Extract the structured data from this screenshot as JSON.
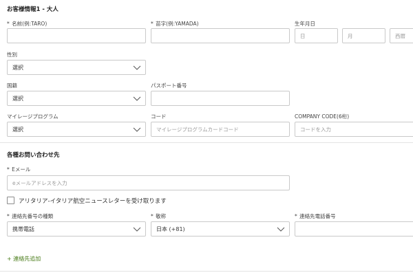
{
  "passenger": {
    "heading": "お客様情報1 - 大人",
    "first_name": {
      "label": "名前(例:TARO)",
      "required_mark": "*",
      "value": ""
    },
    "last_name": {
      "label": "苗字(例:YAMADA)",
      "required_mark": "*",
      "value": ""
    },
    "birth_date": {
      "label": "生年月日",
      "day_placeholder": "日",
      "month_placeholder": "月",
      "year_placeholder": "西暦"
    },
    "gender": {
      "label": "性別",
      "selected": "選択"
    },
    "nationality": {
      "label": "国籍",
      "selected": "選択"
    },
    "passport": {
      "label": "パスポート番号",
      "value": ""
    },
    "mileage_program": {
      "label": "マイレージプログラム",
      "selected": "選択"
    },
    "code": {
      "label": "コード",
      "placeholder": "マイレージプログラムカードコード"
    },
    "company_code": {
      "label": "COMPANY CODE(6桁)",
      "placeholder": "コードを入力"
    }
  },
  "contact": {
    "heading": "各種お問い合わせ先",
    "email": {
      "label": "Eメール",
      "required_mark": "*",
      "placeholder": "eメールアドレスを入力"
    },
    "newsletter_label": "アリタリア-イタリア航空ニュースレターを受け取ります",
    "newsletter_checked": false,
    "phone_type": {
      "label": "連絡先番号の種類",
      "required_mark": "*",
      "selected": "携帯電話"
    },
    "country_code": {
      "label": "敬称",
      "required_mark": "*",
      "selected": "日本 (+81)"
    },
    "phone_number": {
      "label": "連絡先電話番号",
      "required_mark": "*",
      "value": ""
    },
    "add_contact": "+ 連絡先追加"
  },
  "colors": {
    "link": "#4a7c1a",
    "border": "#c9c9c9",
    "divider": "#e3e3e3"
  }
}
